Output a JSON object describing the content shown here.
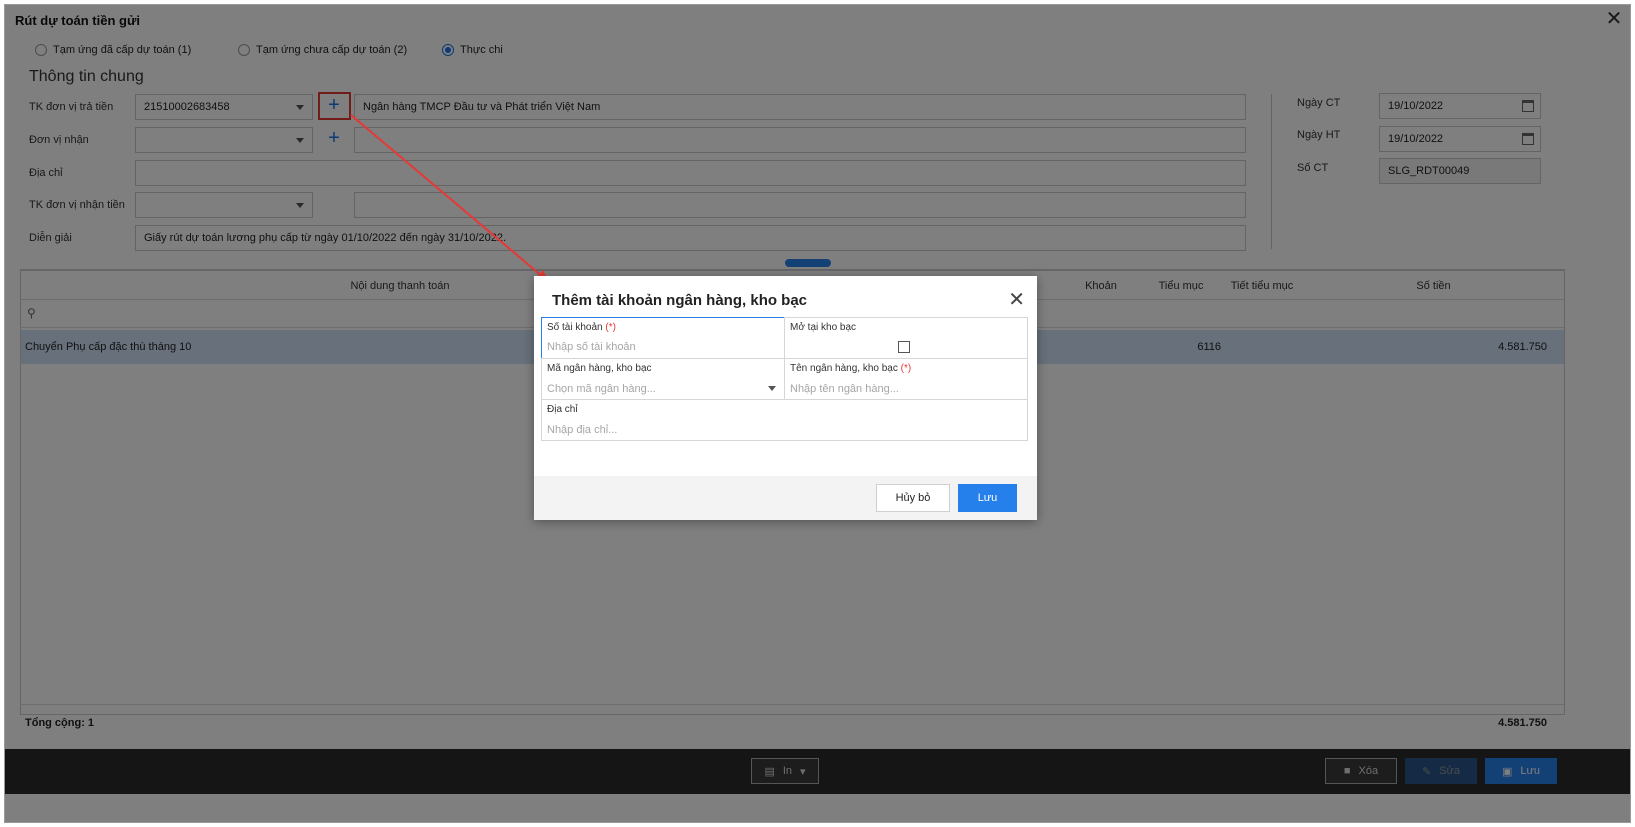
{
  "window": {
    "title": "Rút dự toán tiền gửi"
  },
  "radios": [
    {
      "label": "Tạm ứng đã cấp dự toán (1)",
      "selected": false
    },
    {
      "label": "Tạm ứng chưa cấp dự toán (2)",
      "selected": false
    },
    {
      "label": "Thực chi",
      "selected": true
    }
  ],
  "general": {
    "section_title": "Thông tin chung",
    "payer_account_label": "TK đơn vị trả tiền",
    "payer_account_value": "21510002683458",
    "payer_bank_name": "Ngân hàng TMCP Đầu tư và Phát triển Việt Nam",
    "receiver_label": "Đơn vị nhận",
    "address_label": "Địa chỉ",
    "receiver_account_label": "TK đơn vị nhận tiền",
    "description_label": "Diễn giải",
    "description_value": "Giấy rút dự toán lương phụ cấp từ ngày 01/10/2022 đến ngày 31/10/2022.",
    "doc_date_label": "Ngày CT",
    "doc_date_value": "19/10/2022",
    "post_date_label": "Ngày HT",
    "post_date_value": "19/10/2022",
    "doc_no_label": "Số CT",
    "doc_no_value": "SLG_RDT00049"
  },
  "grid": {
    "columns": [
      "Nội dung thanh toán",
      "Khoản",
      "Tiểu mục",
      "Tiết tiểu mục",
      "Số tiền"
    ],
    "rows": [
      {
        "content": "Chuyển Phụ cấp đặc thù tháng 10",
        "sub_item": "6116",
        "amount": "4.581.750"
      }
    ],
    "total_label": "Tổng cộng: 1",
    "total_amount": "4.581.750"
  },
  "toolbar": {
    "print_label": "In",
    "delete_label": "Xóa",
    "edit_label": "Sửa",
    "save_label": "Lưu"
  },
  "modal": {
    "title": "Thêm tài khoản ngân hàng, kho bạc",
    "account_no_label": "Số tài khoản",
    "required_mark": "(*)",
    "account_no_placeholder": "Nhập số tài khoản",
    "treasury_label": "Mở tại kho bạc",
    "bank_code_label": "Mã ngân hàng, kho bạc",
    "bank_code_placeholder": "Chọn mã ngân hàng...",
    "bank_name_label": "Tên ngân hàng, kho bạc",
    "bank_name_placeholder": "Nhập tên ngân hàng...",
    "address_label": "Địa chỉ",
    "address_placeholder": "Nhập địa chỉ...",
    "cancel_label": "Hủy bỏ",
    "save_label": "Lưu"
  },
  "colors": {
    "accent": "#2680eb",
    "annotation": "#e53935",
    "selected_row": "#cfe0f6"
  }
}
